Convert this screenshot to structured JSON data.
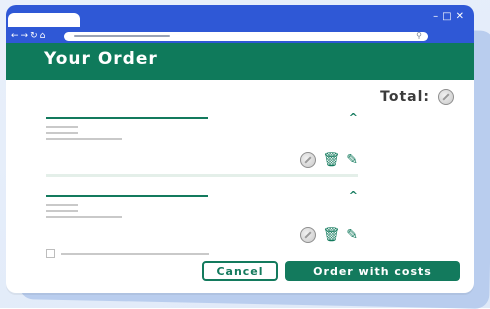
{
  "header": {
    "title": "Your Order"
  },
  "total": {
    "label": "Total:"
  },
  "buttons": {
    "cancel_label": "Cancel",
    "order_label": "Order with costs"
  },
  "colors": {
    "brand_green": "#137a5d",
    "browser_blue": "#2f58d6"
  },
  "icons": {
    "window_controls": [
      "minimize-icon",
      "maximize-icon",
      "close-icon"
    ],
    "nav": [
      "back-icon",
      "forward-icon",
      "reload-icon",
      "home-icon"
    ],
    "item_actions": [
      "coin-icon",
      "trash-icon",
      "pencil-icon"
    ]
  }
}
